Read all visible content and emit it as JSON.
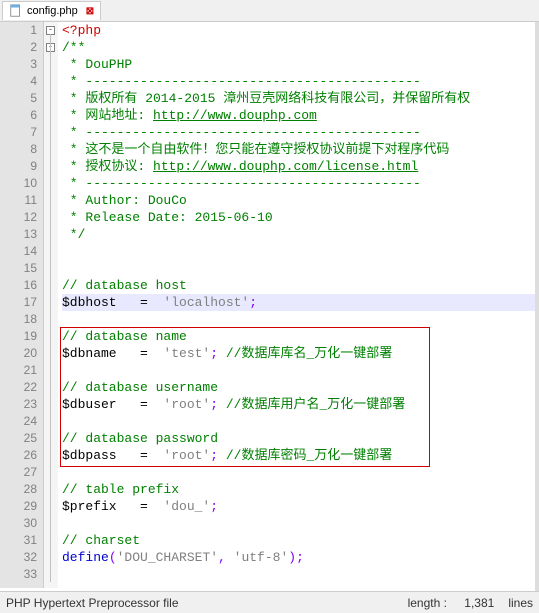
{
  "tab": {
    "filename": "config.php"
  },
  "code": {
    "l1": "<?php",
    "l2": "/**",
    "l3": " * DouPHP",
    "l4": " * -------------------------------------------",
    "l5a": " * 版权所有 2014-2015 漳州豆壳网络科技有限公司，并保留所有权",
    "l6a": " * 网站地址: ",
    "l6b": "http://www.douphp.com",
    "l7": " * -------------------------------------------",
    "l8": " * 这不是一个自由软件！您只能在遵守授权协议前提下对程序代码",
    "l9a": " * 授权协议: ",
    "l9b": "http://www.douphp.com/license.html",
    "l10": " * -------------------------------------------",
    "l11": " * Author: DouCo",
    "l12": " * Release Date: 2015-06-10",
    "l13": " */",
    "l16": "// database host",
    "l17v": "$dbhost",
    "l17s": "'localhost'",
    "l19": "// database name",
    "l20v": "$dbname",
    "l20s": "'test'",
    "l20c": "//数据库库名_万化一键部署",
    "l22": "// database username",
    "l23v": "$dbuser",
    "l23s": "'root'",
    "l23c": "//数据库用户名_万化一键部署",
    "l25": "// database password",
    "l26v": "$dbpass",
    "l26s": "'root'",
    "l26c": "//数据库密码_万化一键部署",
    "l28": "// table prefix",
    "l29v": "$prefix",
    "l29s": "'dou_'",
    "l31": "// charset",
    "l32f": "define",
    "l32a": "'DOU_CHARSET'",
    "l32b": "'utf-8'",
    "eq": "   =  ",
    "semi": ";"
  },
  "status": {
    "type": "PHP Hypertext Preprocessor file",
    "length_label": "length : ",
    "length_value": "1,381",
    "lines_label": "lines"
  }
}
